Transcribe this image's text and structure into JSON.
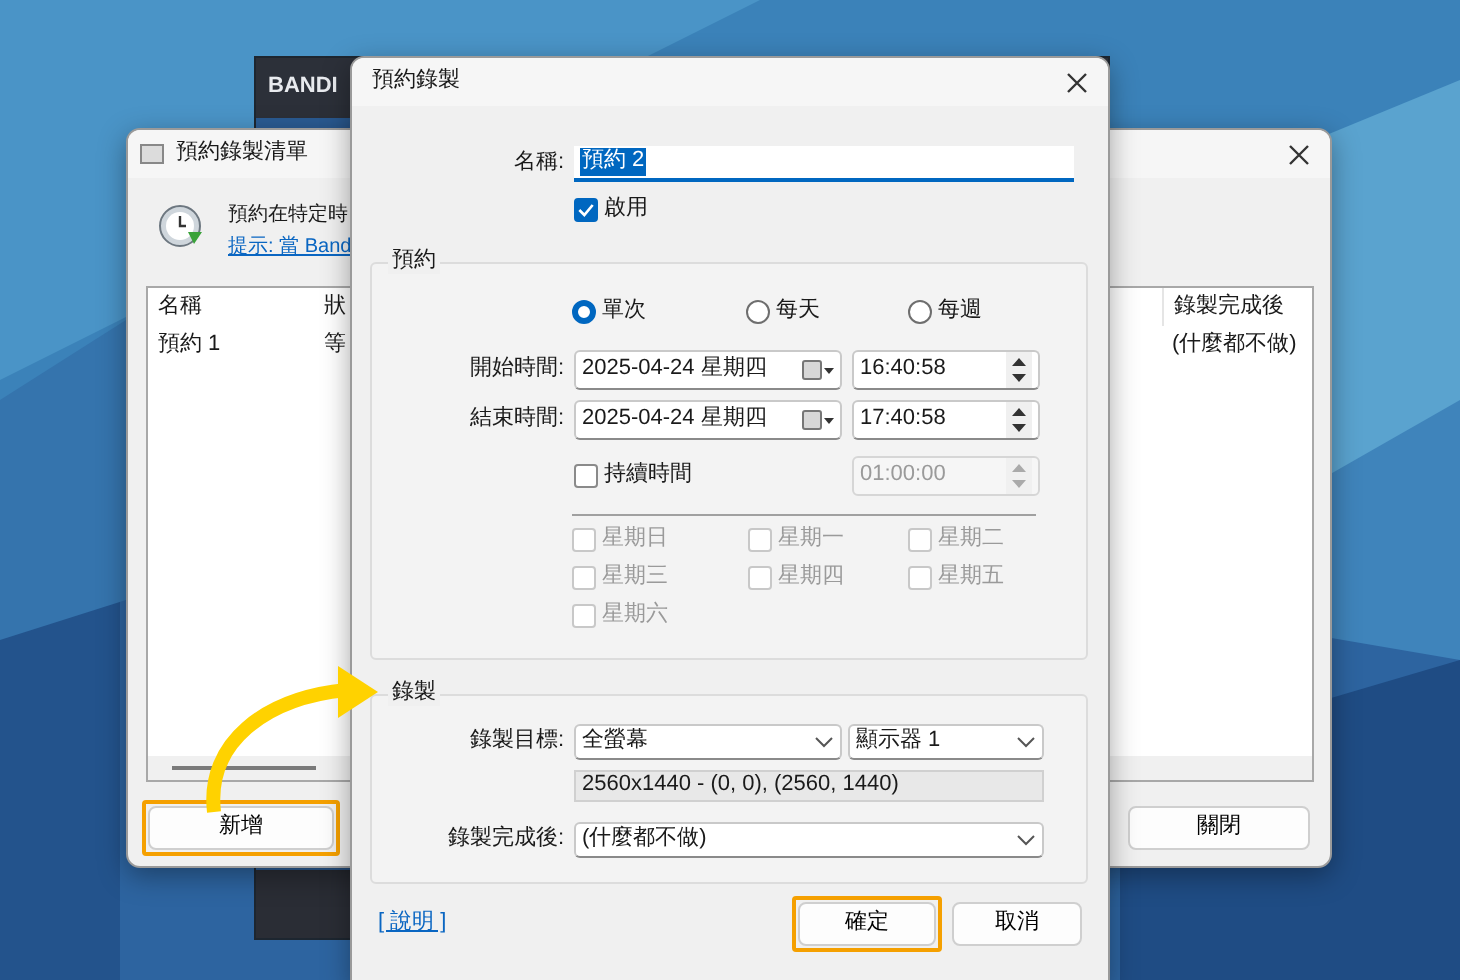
{
  "background_app": {
    "logo": "BANDI"
  },
  "list_window": {
    "title": "預約錄製清單",
    "description": "預約在特定時",
    "hint_link": "提示: 當 Band",
    "columns": [
      "名稱",
      "狀",
      "錄製完成後"
    ],
    "rows": [
      {
        "cells": [
          "預約 1",
          "等",
          "(什麼都不做)"
        ]
      }
    ],
    "buttons": [
      {
        "label": "新增",
        "highlighted": true
      },
      {
        "label": "關閉",
        "highlighted": false
      }
    ]
  },
  "dialog": {
    "title": "預約錄製",
    "name_field": {
      "label": "名稱:",
      "value": "預約 2",
      "text_selected": true
    },
    "enabled": {
      "label": "啟用",
      "checked": true
    },
    "schedule_group": {
      "title": "預約",
      "modes": [
        {
          "label": "單次",
          "selected": true
        },
        {
          "label": "每天",
          "selected": false
        },
        {
          "label": "每週",
          "selected": false
        }
      ],
      "start": {
        "label": "開始時間:",
        "date": "2025-04-24 星期四",
        "time": "16:40:58"
      },
      "end": {
        "label": "結束時間:",
        "date": "2025-04-24 星期四",
        "time": "17:40:58"
      },
      "duration": {
        "label": "持續時間",
        "checked": false,
        "value": "01:00:00",
        "disabled": true
      },
      "weekdays": [
        {
          "label": "星期日",
          "checked": false,
          "disabled": true
        },
        {
          "label": "星期一",
          "checked": false,
          "disabled": true
        },
        {
          "label": "星期二",
          "checked": false,
          "disabled": true
        },
        {
          "label": "星期三",
          "checked": false,
          "disabled": true
        },
        {
          "label": "星期四",
          "checked": false,
          "disabled": true
        },
        {
          "label": "星期五",
          "checked": false,
          "disabled": true
        },
        {
          "label": "星期六",
          "checked": false,
          "disabled": true
        }
      ]
    },
    "record_group": {
      "title": "錄製",
      "target_label": "錄製目標:",
      "target": "全螢幕",
      "monitor": "顯示器 1",
      "info": "2560x1440 - (0, 0), (2560, 1440)",
      "after_label": "錄製完成後:",
      "after": "(什麼都不做)"
    },
    "help_link": "[ 說明 ]",
    "buttons": [
      {
        "label": "確定",
        "highlighted": true
      },
      {
        "label": "取消",
        "highlighted": false
      }
    ]
  }
}
